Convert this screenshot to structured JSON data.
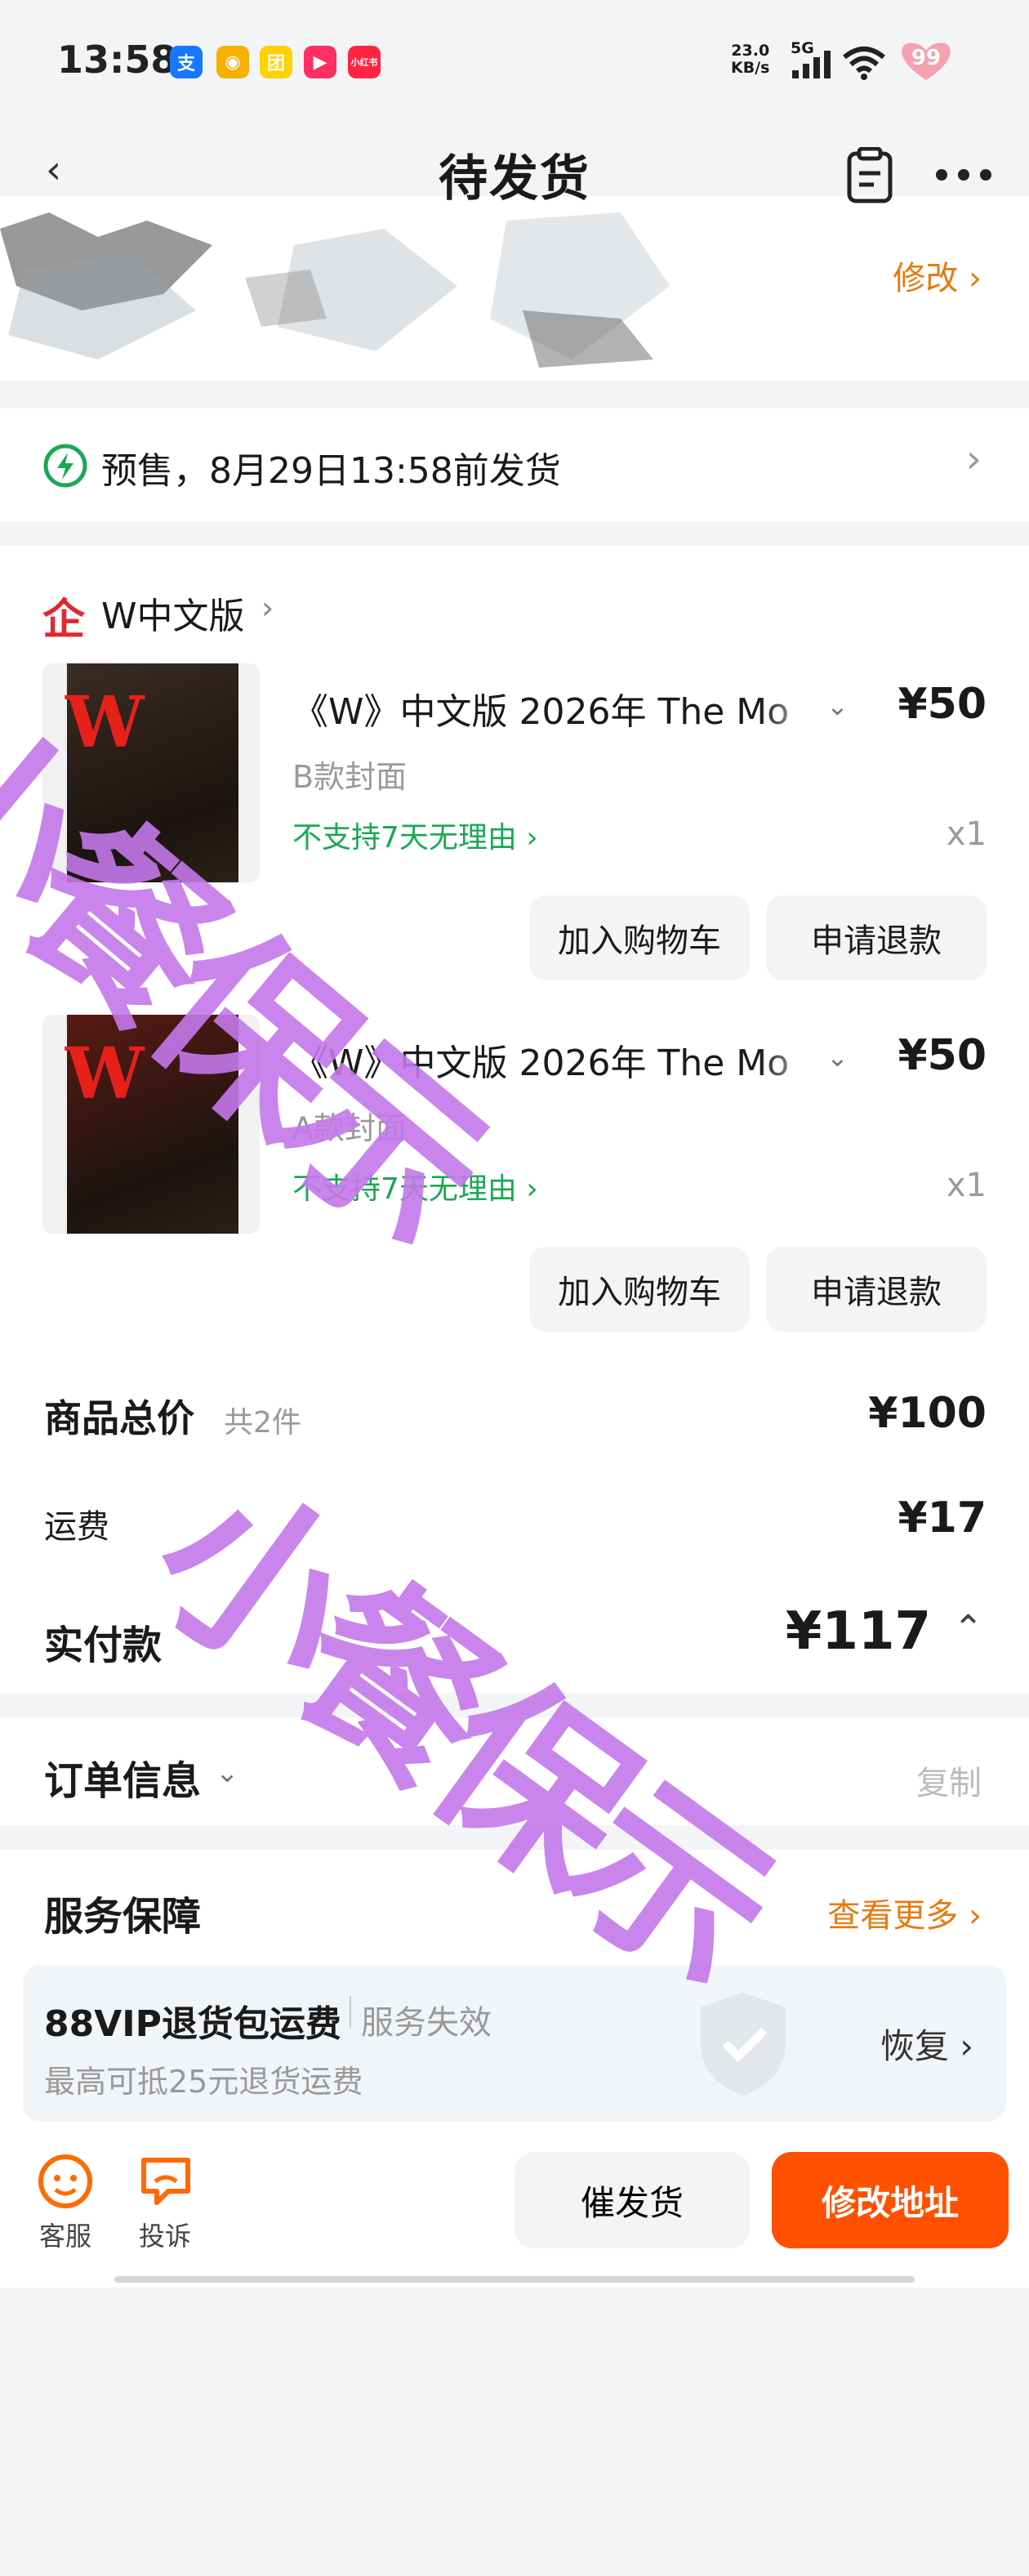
{
  "status_bar": {
    "time": "13:58",
    "network_speed_value": "23.0",
    "network_speed_unit": "KB/s",
    "network_type": "5G",
    "battery": "99",
    "app_icons": [
      {
        "name": "alipay-icon",
        "glyph": "支",
        "color": "#1677ff"
      },
      {
        "name": "weibo-icon",
        "glyph": "◉",
        "color": "#f5b000"
      },
      {
        "name": "meituan-icon",
        "glyph": "团",
        "color": "#ffd100"
      },
      {
        "name": "video-icon",
        "glyph": "▶",
        "color": "#ff2e63"
      },
      {
        "name": "xiaohongshu-icon",
        "glyph": "小红书",
        "color": "#ff2442"
      }
    ]
  },
  "nav": {
    "title": "待发货"
  },
  "address": {
    "edit_label": "修改"
  },
  "presale": {
    "text": "预售，8月29日13:58前发货"
  },
  "shop": {
    "name": "W中文版",
    "logo_glyph": "企"
  },
  "products": [
    {
      "title": "《W》中文版 2026年 The Mo",
      "price": "¥50",
      "sku": "B款封面",
      "policy": "不支持7天无理由",
      "qty": "x1",
      "add_cart": "加入购物车",
      "refund": "申请退款",
      "cover_bg": "#3a2c22"
    },
    {
      "title": "《W》中文版 2026年 The Mo",
      "price": "¥50",
      "sku": "A款封面",
      "policy": "不支持7天无理由",
      "qty": "x1",
      "add_cart": "加入购物车",
      "refund": "申请退款",
      "cover_bg": "#5a1a14"
    }
  ],
  "summary": {
    "goods_total_label": "商品总价",
    "goods_count": "共2件",
    "goods_total": "¥100",
    "shipping_label": "运费",
    "shipping": "¥17",
    "paid_label": "实付款",
    "paid": "¥117"
  },
  "order_info": {
    "label": "订单信息",
    "copy_label": "复制"
  },
  "service": {
    "label": "服务保障",
    "more_label": "查看更多",
    "vip_title": "88VIP退货包运费",
    "vip_status": "服务失效",
    "vip_desc": "最高可抵25元退货运费",
    "restore_label": "恢复"
  },
  "bottom_bar": {
    "service_label": "客服",
    "complaint_label": "投诉",
    "urge_label": "催发货",
    "modify_address_label": "修改地址"
  },
  "colors": {
    "accent_orange": "#ff5000",
    "link_orange": "#e8790f",
    "policy_green": "#1aa854",
    "presale_green": "#1aa854",
    "shop_red": "#e0282e",
    "watermark": "#c478ea"
  },
  "watermark": {
    "line1": "小餐保示",
    "line2": "小餐保示"
  }
}
